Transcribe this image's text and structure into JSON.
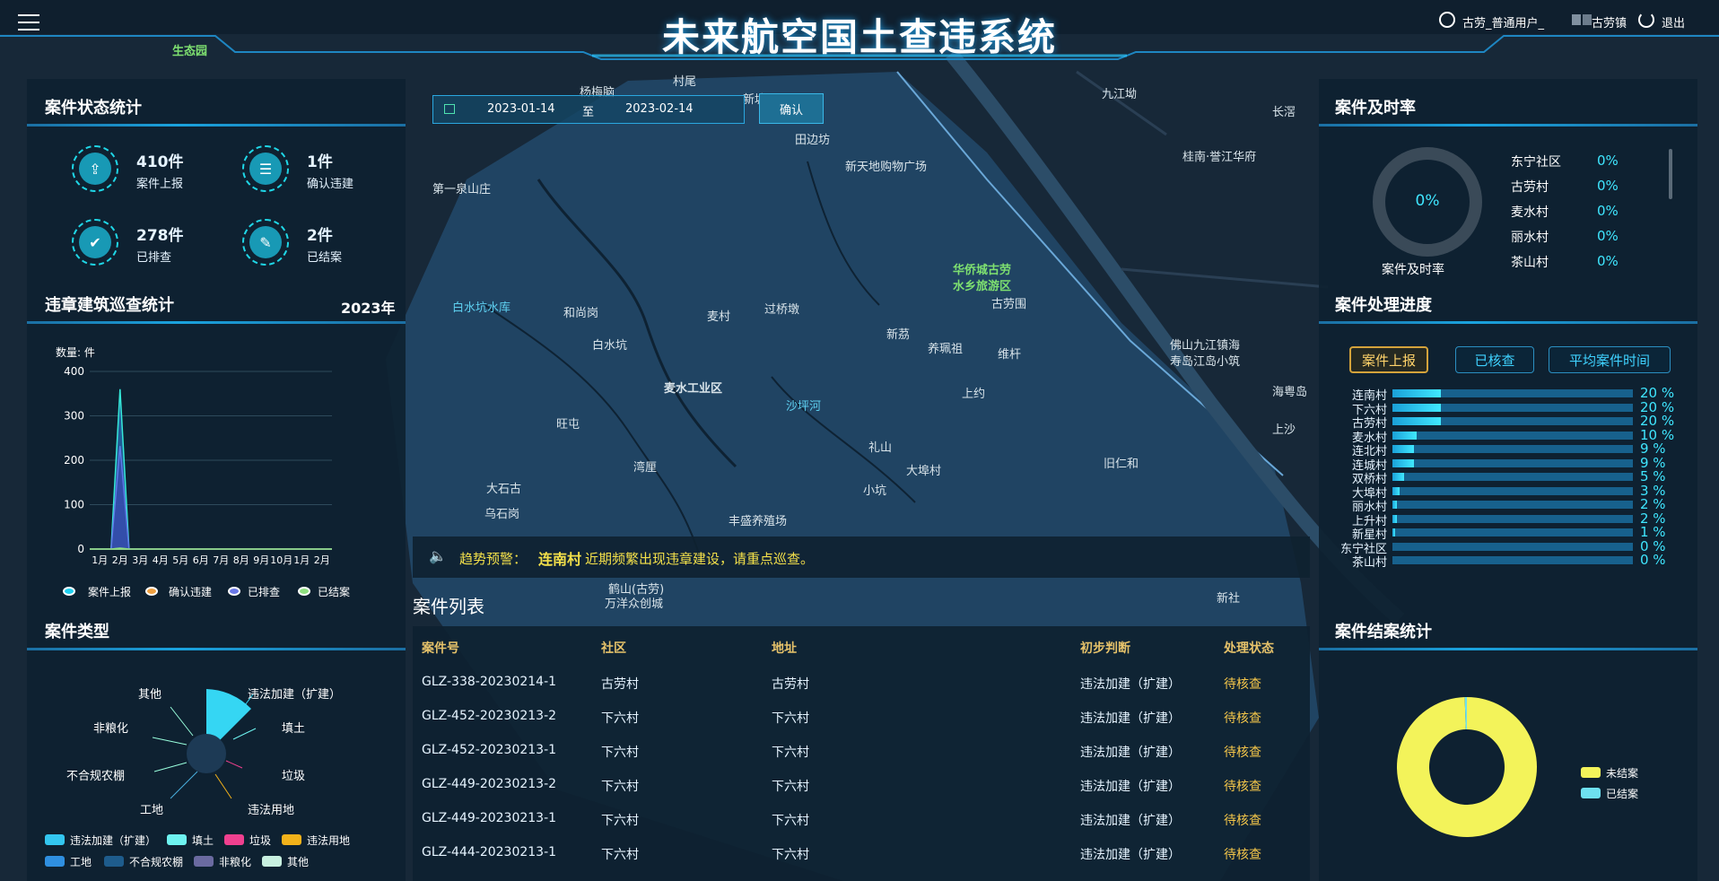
{
  "header": {
    "title": "未来航空国土查违系统",
    "user": "古劳_普通用户_",
    "town": "古劳镇",
    "logout": "退出"
  },
  "date_filter": {
    "start": "2023-01-14",
    "separator": "至",
    "end": "2023-02-14",
    "confirm": "确认"
  },
  "case_stats": {
    "title": "案件状态统计",
    "items": [
      {
        "value": "410件",
        "label": "案件上报",
        "icon": "upload-icon"
      },
      {
        "value": "1件",
        "label": "确认违建",
        "icon": "document-icon"
      },
      {
        "value": "278件",
        "label": "已排查",
        "icon": "shield-check-icon"
      },
      {
        "value": "2件",
        "label": "已结案",
        "icon": "clipboard-check-icon"
      }
    ]
  },
  "patrol": {
    "title": "违章建筑巡查统计",
    "year": "2023年",
    "unit": "数量: 件",
    "legend": [
      "案件上报",
      "确认违建",
      "已排查",
      "已结案"
    ]
  },
  "case_types": {
    "title": "案件类型",
    "labels": [
      "违法加建（扩建）",
      "填土",
      "垃圾",
      "违法用地",
      "工地",
      "不合规农棚",
      "非粮化",
      "其他"
    ],
    "legend": [
      {
        "name": "违法加建（扩建）",
        "color": "#33c6f0"
      },
      {
        "name": "填土",
        "color": "#6ef3f0"
      },
      {
        "name": "垃圾",
        "color": "#f0408f"
      },
      {
        "name": "违法用地",
        "color": "#f3b21a"
      },
      {
        "name": "工地",
        "color": "#2f8fe0"
      },
      {
        "name": "不合规农棚",
        "color": "#1e5c8c"
      },
      {
        "name": "非粮化",
        "color": "#6a6aa0"
      },
      {
        "name": "其他",
        "color": "#c8f0e0"
      }
    ]
  },
  "alert": {
    "prefix": "趋势预警：",
    "village": "连南村",
    "text": "近期频繁出现违章建设，请重点巡查。"
  },
  "case_list": {
    "title": "案件列表",
    "columns": [
      "案件号",
      "社区",
      "地址",
      "初步判断",
      "处理状态"
    ],
    "rows": [
      [
        "GLZ-338-20230214-1",
        "古劳村",
        "古劳村",
        "违法加建（扩建）",
        "待核查"
      ],
      [
        "GLZ-452-20230213-2",
        "下六村",
        "下六村",
        "违法加建（扩建）",
        "待核查"
      ],
      [
        "GLZ-452-20230213-1",
        "下六村",
        "下六村",
        "违法加建（扩建）",
        "待核查"
      ],
      [
        "GLZ-449-20230213-2",
        "下六村",
        "下六村",
        "违法加建（扩建）",
        "待核查"
      ],
      [
        "GLZ-449-20230213-1",
        "下六村",
        "下六村",
        "违法加建（扩建）",
        "待核查"
      ],
      [
        "GLZ-444-20230213-1",
        "下六村",
        "下六村",
        "违法加建（扩建）",
        "待核查"
      ]
    ]
  },
  "timeliness": {
    "title": "案件及时率",
    "center": "0%",
    "caption": "案件及时率",
    "rows": [
      {
        "name": "东宁社区",
        "value": "0%"
      },
      {
        "name": "古劳村",
        "value": "0%"
      },
      {
        "name": "麦水村",
        "value": "0%"
      },
      {
        "name": "丽水村",
        "value": "0%"
      },
      {
        "name": "茶山村",
        "value": "0%"
      }
    ]
  },
  "progress": {
    "title": "案件处理进度",
    "tabs": [
      "案件上报",
      "已核查",
      "平均案件时间"
    ],
    "rows": [
      {
        "name": "连南村",
        "pct": 20,
        "label": "20 %"
      },
      {
        "name": "下六村",
        "pct": 20,
        "label": "20 %"
      },
      {
        "name": "古劳村",
        "pct": 20,
        "label": "20 %"
      },
      {
        "name": "麦水村",
        "pct": 10,
        "label": "10 %"
      },
      {
        "name": "连北村",
        "pct": 9,
        "label": "9 %"
      },
      {
        "name": "连城村",
        "pct": 9,
        "label": "9 %"
      },
      {
        "name": "双桥村",
        "pct": 5,
        "label": "5 %"
      },
      {
        "name": "大埠村",
        "pct": 3,
        "label": "3 %"
      },
      {
        "name": "丽水村",
        "pct": 2,
        "label": "2 %"
      },
      {
        "name": "上升村",
        "pct": 2,
        "label": "2 %"
      },
      {
        "name": "新星村",
        "pct": 1,
        "label": "1 %"
      },
      {
        "name": "东宁社区",
        "pct": 0,
        "label": "0 %"
      },
      {
        "name": "茶山村",
        "pct": 0,
        "label": "0 %"
      }
    ]
  },
  "closure": {
    "title": "案件结案统计",
    "legend": [
      {
        "name": "未结案",
        "color": "#f3f35a"
      },
      {
        "name": "已结案",
        "color": "#6ee0f0"
      }
    ]
  },
  "map_labels": [
    "村尾",
    "杨梅脑",
    "新塘",
    "田边坊",
    "新天地购物广场",
    "第一泉山庄",
    "白水坑水库",
    "和尚岗",
    "麦村",
    "过桥墩",
    "白水坑",
    "麦水工业区",
    "华侨城古劳",
    "水乡旅游区",
    "古劳围",
    "新茘",
    "养珮祖",
    "维杆",
    "旺屯",
    "沙坪河",
    "上约",
    "湾厘",
    "礼山",
    "大埠村",
    "小坑",
    "大石古",
    "乌石岗",
    "丰盛养殖场",
    "九江坳",
    "长滘",
    "桂南·誉江华府",
    "佛山九江镇海",
    "寿岛江岛小筑",
    "海粤岛",
    "上沙",
    "旧仁和",
    "鹤山(古劳)",
    "万洋众创城",
    "新社",
    "生态园",
    "古劳镇"
  ],
  "chart_data": [
    {
      "type": "area",
      "title": "违章建筑巡查统计",
      "ylabel": "数量: 件",
      "categories": [
        "1月",
        "2月",
        "3月",
        "4月",
        "5月",
        "6月",
        "7月",
        "8月",
        "9月",
        "10月",
        "1月",
        "2月"
      ],
      "ylim": [
        0,
        400
      ],
      "yticks": [
        0,
        100,
        200,
        300,
        400
      ],
      "series": [
        {
          "name": "案件上报",
          "values": [
            0,
            360,
            0,
            0,
            0,
            0,
            0,
            0,
            0,
            0,
            0,
            0
          ]
        },
        {
          "name": "确认违建",
          "values": [
            0,
            1,
            0,
            0,
            0,
            0,
            0,
            0,
            0,
            0,
            0,
            0
          ]
        },
        {
          "name": "已排查",
          "values": [
            0,
            232,
            0,
            0,
            0,
            0,
            0,
            0,
            0,
            0,
            0,
            0
          ]
        },
        {
          "name": "已结案",
          "values": [
            0,
            2,
            0,
            0,
            0,
            0,
            0,
            0,
            0,
            0,
            0,
            0
          ]
        }
      ]
    },
    {
      "type": "pie",
      "title": "案件结案统计",
      "categories": [
        "未结案",
        "已结案"
      ],
      "values": [
        408,
        2
      ]
    }
  ]
}
